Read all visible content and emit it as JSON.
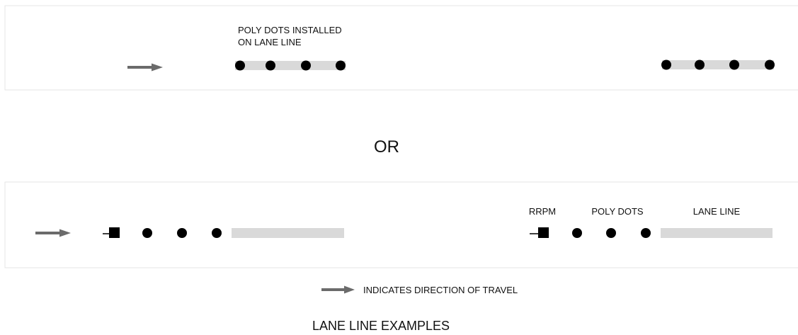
{
  "panel_top": {
    "callout_label_line1": "POLY DOTS INSTALLED",
    "callout_label_line2": "ON LANE LINE"
  },
  "separator_text": "OR",
  "panel_bottom": {
    "label_rrpm": "RRPM",
    "label_poly_dots": "POLY DOTS",
    "label_lane_line": "LANE LINE"
  },
  "legend": {
    "text": "INDICATES DIRECTION OF TRAVEL"
  },
  "figure_title": "LANE LINE EXAMPLES",
  "colors": {
    "lane_line": "#d9d9d9",
    "arrow": "#6b6b6b",
    "dot": "#000000",
    "panel_border": "#e6e6e6"
  }
}
